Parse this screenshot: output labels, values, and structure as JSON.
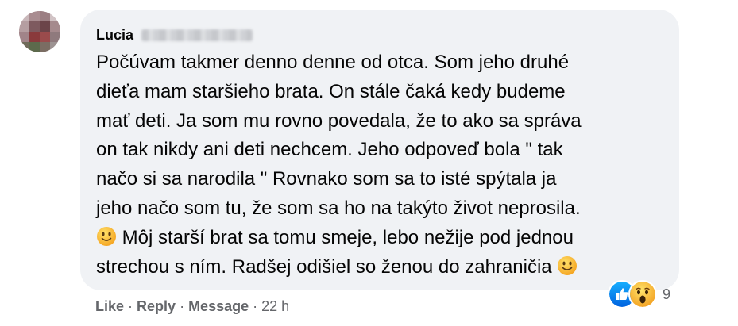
{
  "comment": {
    "author_name": "Lucia",
    "lines": [
      "Počúvam takmer denno denne od otca. Som jeho druhé",
      "dieťa mam staršieho brata. On stále čaká kedy budeme",
      "mať deti. Ja som mu rovno povedala, že to ako sa správa",
      "on tak nikdy ani deti nechcem. Jeho odpoveď bola \" tak",
      "načo si sa narodila \" Rovnako som sa to isté spýtala ja",
      "jeho načo som tu, že som sa ho na takýto život neprosila."
    ],
    "line7_text": " Môj starší brat sa tomu smeje, lebo nežije pod jednou",
    "line8_text": "strechou s ním. Radšej odišiel so ženou do zahraničia ",
    "emoji": "slightly-smiling-face-icon"
  },
  "reactions": {
    "icons": [
      "like-reaction-icon",
      "wow-reaction-icon"
    ],
    "count": "9",
    "colors": {
      "like": "#1877f2",
      "wow": "#f7b125"
    }
  },
  "actions": {
    "like": "Like",
    "reply": "Reply",
    "message": "Message",
    "separator": "·",
    "time": "22 h"
  },
  "colors": {
    "bubble_bg": "#f0f2f5",
    "text": "#050505",
    "secondary_text": "#65676b"
  }
}
